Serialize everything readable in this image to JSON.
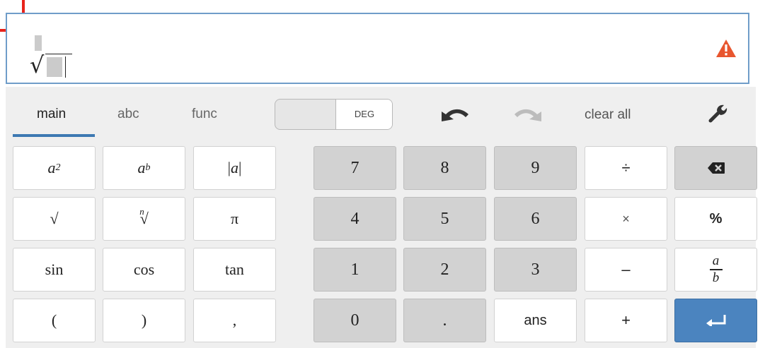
{
  "display": {
    "expression": "n-th root (empty)",
    "warning_icon": "warning-icon",
    "warning_color": "#e8562f"
  },
  "tabs": [
    {
      "label": "main",
      "active": true
    },
    {
      "label": "abc",
      "active": false
    },
    {
      "label": "func",
      "active": false
    }
  ],
  "mode_toggle": {
    "label": "DEG"
  },
  "toolbar": {
    "undo_icon": "undo-icon",
    "redo_icon": "redo-icon",
    "clear_all": "clear all",
    "settings_icon": "wrench-icon"
  },
  "keys": {
    "square": {
      "base": "a",
      "exp": "2"
    },
    "power": {
      "base": "a",
      "exp": "b"
    },
    "abs": {
      "left": "|",
      "mid": "a",
      "right": "|"
    },
    "sqrt": "√",
    "nth_root": {
      "index": "n",
      "sign": "√"
    },
    "pi": "π",
    "sin": "sin",
    "cos": "cos",
    "tan": "tan",
    "lparen": "(",
    "rparen": ")",
    "comma": ",",
    "n7": "7",
    "n8": "8",
    "n9": "9",
    "n4": "4",
    "n5": "5",
    "n6": "6",
    "n1": "1",
    "n2": "2",
    "n3": "3",
    "n0": "0",
    "dot": ".",
    "ans": "ans",
    "divide": "÷",
    "times": "×",
    "minus": "–",
    "plus": "+",
    "percent": "%",
    "fraction": {
      "num": "a",
      "den": "b"
    },
    "backspace_icon": "backspace-icon",
    "enter_icon": "enter-icon"
  },
  "colors": {
    "accent": "#3d79b2",
    "enter_key": "#4b84bf",
    "number_keys": "#d2d2d2",
    "display_border": "#6f9dc9"
  }
}
